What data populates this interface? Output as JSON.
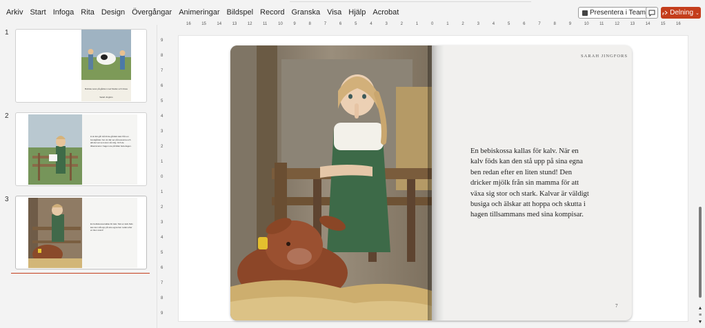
{
  "menu": {
    "tabs": [
      "Arkiv",
      "Start",
      "Infoga",
      "Rita",
      "Design",
      "Övergångar",
      "Animeringar",
      "Bildspel",
      "Record",
      "Granska",
      "Visa",
      "Hjälp",
      "Acrobat"
    ],
    "present_label": "Presentera i Teams",
    "share_label": "Delning"
  },
  "slides": [
    {
      "number": "1",
      "cover_title": "Bolinka Lévé på gården med Stefan och Cissa",
      "cover_author": "Sarah Jingfors"
    },
    {
      "number": "2",
      "thumb_text": "H är där går två till de gårdsin kalv från en bondgården hon är där ser på kossorna och allt det var som kom så rolig. Och de tillsammans i hagen ute på fältet hela dagen."
    },
    {
      "number": "3",
      "thumb_text": "En bebiskossa kallas för kalv. När en kalv föds kan den stå upp på sina egna ben redan efter en liten stund!"
    }
  ],
  "ruler": {
    "horizontal": [
      "16",
      "15",
      "14",
      "13",
      "12",
      "11",
      "10",
      "9",
      "8",
      "7",
      "6",
      "5",
      "4",
      "3",
      "2",
      "1",
      "0",
      "1",
      "2",
      "3",
      "4",
      "5",
      "6",
      "7",
      "8",
      "9",
      "10",
      "11",
      "12",
      "13",
      "14",
      "15",
      "16"
    ],
    "vertical": [
      "9",
      "8",
      "7",
      "6",
      "5",
      "4",
      "3",
      "2",
      "1",
      "0",
      "1",
      "2",
      "3",
      "4",
      "5",
      "6",
      "7",
      "8",
      "9"
    ]
  },
  "page": {
    "author": "SARAH JINGFORS",
    "story_lines": [
      "En bebiskossa kallas för kalv. När en",
      "kalv föds kan den stå upp på sina egna",
      "ben redan efter en liten stund! Den",
      "dricker mjölk från sin mamma för att",
      "växa sig stor och stark. Kalvar är väldigt",
      "busiga och älskar att hoppa och skutta i",
      "hagen tillsammans med sina kompisar."
    ],
    "page_number": "7"
  },
  "colors": {
    "accent": "#c43e1c",
    "paper": "#f1f0ee",
    "background": "#f3f3f3"
  }
}
